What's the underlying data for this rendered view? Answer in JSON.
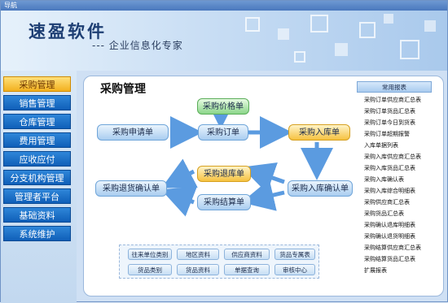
{
  "window": {
    "title": "导航"
  },
  "banner": {
    "brand": "速盈软件",
    "slogan": "--- 企业信息化专家"
  },
  "sidebar": {
    "items": [
      "采购管理",
      "销售管理",
      "仓库管理",
      "费用管理",
      "应收应付",
      "分支机构管理",
      "管理者平台",
      "基础资料",
      "系统维护"
    ],
    "active": "采购管理"
  },
  "main": {
    "title": "采购管理",
    "flow": {
      "price_list": "采购价格单",
      "request": "采购申请单",
      "order": "采购订单",
      "stock_in": "采购入库单",
      "return_confirm": "采购退货确认单",
      "return": "采购退库单",
      "settlement": "采购结算单",
      "stock_in_confirm": "采购入库确认单"
    },
    "quick_links": [
      "往来单位类别",
      "地区资料",
      "供应商资料",
      "货品专属表",
      "货品类别",
      "货品资料",
      "单据查询",
      "审核中心"
    ]
  },
  "reports": {
    "header": "常用报表",
    "items": [
      "采购订单供应商汇总表",
      "采购订单货品汇总表",
      "采购订单今日到货表",
      "采购订单超期报警",
      "入库单据列表",
      "采购入库供应商汇总表",
      "采购入库货品汇总表",
      "采购入库确认表",
      "采购入库综合明细表",
      "采购供应商汇总表",
      "采购货品汇总表",
      "采购确认退库明细表",
      "采购确认退货明细表",
      "采购结算供应商汇总表",
      "采购结算货品汇总表",
      "扩展报表"
    ]
  },
  "colors": {
    "accent_blue": "#0f5fb8",
    "active_orange": "#f2b01e",
    "node_green": "#8bd68a"
  }
}
